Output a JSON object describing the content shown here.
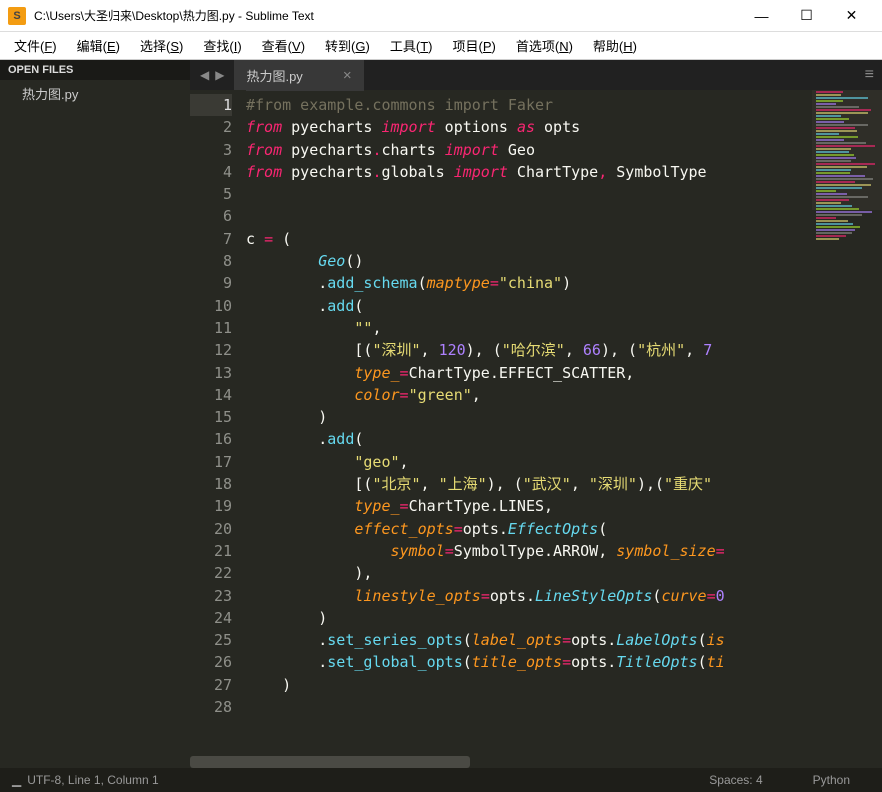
{
  "titlebar": {
    "icon_letter": "S",
    "title": "C:\\Users\\大圣归来\\Desktop\\热力图.py - Sublime Text"
  },
  "win": {
    "min": "—",
    "max": "☐",
    "close": "✕"
  },
  "menu": [
    {
      "t": "文件(",
      "u": "F",
      "s": ")"
    },
    {
      "t": "编辑(",
      "u": "E",
      "s": ")"
    },
    {
      "t": "选择(",
      "u": "S",
      "s": ")"
    },
    {
      "t": "查找(",
      "u": "I",
      "s": ")"
    },
    {
      "t": "查看(",
      "u": "V",
      "s": ")"
    },
    {
      "t": "转到(",
      "u": "G",
      "s": ")"
    },
    {
      "t": "工具(",
      "u": "T",
      "s": ")"
    },
    {
      "t": "项目(",
      "u": "P",
      "s": ")"
    },
    {
      "t": "首选项(",
      "u": "N",
      "s": ")"
    },
    {
      "t": "帮助(",
      "u": "H",
      "s": ")"
    }
  ],
  "sidebar": {
    "header": "OPEN FILES",
    "items": [
      "热力图.py"
    ]
  },
  "tabs": {
    "nav_prev": "◀",
    "nav_next": "▶",
    "active_name": "热力图.py",
    "close": "×",
    "hamburger": "≡"
  },
  "code": {
    "lines": [
      {
        "n": 1,
        "active": true,
        "seg": [
          [
            "cm",
            "#from example.commons import Faker"
          ]
        ]
      },
      {
        "n": 2,
        "seg": [
          [
            "kw",
            "from"
          ],
          [
            "wp",
            " pyecharts "
          ],
          [
            "kw",
            "import"
          ],
          [
            "wp",
            " options "
          ],
          [
            "kw",
            "as"
          ],
          [
            "wp",
            " opts"
          ]
        ]
      },
      {
        "n": 3,
        "seg": [
          [
            "kw",
            "from"
          ],
          [
            "wp",
            " pyecharts"
          ],
          [
            "op",
            "."
          ],
          [
            "wp",
            "charts "
          ],
          [
            "kw",
            "import"
          ],
          [
            "wp",
            " Geo"
          ]
        ]
      },
      {
        "n": 4,
        "seg": [
          [
            "kw",
            "from"
          ],
          [
            "wp",
            " pyecharts"
          ],
          [
            "op",
            "."
          ],
          [
            "wp",
            "globals "
          ],
          [
            "kw",
            "import"
          ],
          [
            "wp",
            " ChartType"
          ],
          [
            "op",
            ","
          ],
          [
            "wp",
            " SymbolType"
          ]
        ]
      },
      {
        "n": 5,
        "seg": []
      },
      {
        "n": 6,
        "seg": []
      },
      {
        "n": 7,
        "seg": [
          [
            "wp",
            "c "
          ],
          [
            "op",
            "="
          ],
          [
            "wp",
            " ("
          ]
        ]
      },
      {
        "n": 8,
        "seg": [
          [
            "wp",
            "        "
          ],
          [
            "cls",
            "Geo"
          ],
          [
            "wp",
            "()"
          ]
        ]
      },
      {
        "n": 9,
        "seg": [
          [
            "wp",
            "        ."
          ],
          [
            "fn",
            "add_schema"
          ],
          [
            "wp",
            "("
          ],
          [
            "par",
            "maptype"
          ],
          [
            "op",
            "="
          ],
          [
            "str",
            "\"china\""
          ],
          [
            "wp",
            ")"
          ]
        ]
      },
      {
        "n": 10,
        "seg": [
          [
            "wp",
            "        ."
          ],
          [
            "fn",
            "add"
          ],
          [
            "wp",
            "("
          ]
        ]
      },
      {
        "n": 11,
        "seg": [
          [
            "wp",
            "            "
          ],
          [
            "str",
            "\"\""
          ],
          [
            "wp",
            ","
          ]
        ]
      },
      {
        "n": 12,
        "seg": [
          [
            "wp",
            "            [("
          ],
          [
            "str",
            "\"深圳\""
          ],
          [
            "wp",
            ", "
          ],
          [
            "num",
            "120"
          ],
          [
            "wp",
            "), ("
          ],
          [
            "str",
            "\"哈尔滨\""
          ],
          [
            "wp",
            ", "
          ],
          [
            "num",
            "66"
          ],
          [
            "wp",
            "), ("
          ],
          [
            "str",
            "\"杭州\""
          ],
          [
            "wp",
            ", "
          ],
          [
            "num",
            "7"
          ]
        ]
      },
      {
        "n": 13,
        "seg": [
          [
            "wp",
            "            "
          ],
          [
            "par",
            "type_"
          ],
          [
            "op",
            "="
          ],
          [
            "wp",
            "ChartType.EFFECT_SCATTER,"
          ]
        ]
      },
      {
        "n": 14,
        "seg": [
          [
            "wp",
            "            "
          ],
          [
            "par",
            "color"
          ],
          [
            "op",
            "="
          ],
          [
            "str",
            "\"green\""
          ],
          [
            "wp",
            ","
          ]
        ]
      },
      {
        "n": 15,
        "seg": [
          [
            "wp",
            "        )"
          ]
        ]
      },
      {
        "n": 16,
        "seg": [
          [
            "wp",
            "        ."
          ],
          [
            "fn",
            "add"
          ],
          [
            "wp",
            "("
          ]
        ]
      },
      {
        "n": 17,
        "seg": [
          [
            "wp",
            "            "
          ],
          [
            "str",
            "\"geo\""
          ],
          [
            "wp",
            ","
          ]
        ]
      },
      {
        "n": 18,
        "seg": [
          [
            "wp",
            "            [("
          ],
          [
            "str",
            "\"北京\""
          ],
          [
            "wp",
            ", "
          ],
          [
            "str",
            "\"上海\""
          ],
          [
            "wp",
            "), ("
          ],
          [
            "str",
            "\"武汉\""
          ],
          [
            "wp",
            ", "
          ],
          [
            "str",
            "\"深圳\""
          ],
          [
            "wp",
            "),("
          ],
          [
            "str",
            "\"重庆\""
          ]
        ]
      },
      {
        "n": 19,
        "seg": [
          [
            "wp",
            "            "
          ],
          [
            "par",
            "type_"
          ],
          [
            "op",
            "="
          ],
          [
            "wp",
            "ChartType.LINES,"
          ]
        ]
      },
      {
        "n": 20,
        "seg": [
          [
            "wp",
            "            "
          ],
          [
            "par",
            "effect_opts"
          ],
          [
            "op",
            "="
          ],
          [
            "wp",
            "opts."
          ],
          [
            "cls",
            "EffectOpts"
          ],
          [
            "wp",
            "("
          ]
        ]
      },
      {
        "n": 21,
        "seg": [
          [
            "wp",
            "                "
          ],
          [
            "par",
            "symbol"
          ],
          [
            "op",
            "="
          ],
          [
            "wp",
            "SymbolType.ARROW, "
          ],
          [
            "par",
            "symbol_size"
          ],
          [
            "op",
            "="
          ]
        ]
      },
      {
        "n": 22,
        "seg": [
          [
            "wp",
            "            ),"
          ]
        ]
      },
      {
        "n": 23,
        "seg": [
          [
            "wp",
            "            "
          ],
          [
            "par",
            "linestyle_opts"
          ],
          [
            "op",
            "="
          ],
          [
            "wp",
            "opts."
          ],
          [
            "cls",
            "LineStyleOpts"
          ],
          [
            "wp",
            "("
          ],
          [
            "par",
            "curve"
          ],
          [
            "op",
            "="
          ],
          [
            "num",
            "0"
          ]
        ]
      },
      {
        "n": 24,
        "seg": [
          [
            "wp",
            "        )"
          ]
        ]
      },
      {
        "n": 25,
        "seg": [
          [
            "wp",
            "        ."
          ],
          [
            "fn",
            "set_series_opts"
          ],
          [
            "wp",
            "("
          ],
          [
            "par",
            "label_opts"
          ],
          [
            "op",
            "="
          ],
          [
            "wp",
            "opts."
          ],
          [
            "cls",
            "LabelOpts"
          ],
          [
            "wp",
            "("
          ],
          [
            "par",
            "is"
          ]
        ]
      },
      {
        "n": 26,
        "seg": [
          [
            "wp",
            "        ."
          ],
          [
            "fn",
            "set_global_opts"
          ],
          [
            "wp",
            "("
          ],
          [
            "par",
            "title_opts"
          ],
          [
            "op",
            "="
          ],
          [
            "wp",
            "opts."
          ],
          [
            "cls",
            "TitleOpts"
          ],
          [
            "wp",
            "("
          ],
          [
            "par",
            "ti"
          ]
        ]
      },
      {
        "n": 27,
        "seg": [
          [
            "wp",
            "    )"
          ]
        ]
      },
      {
        "n": 28,
        "seg": []
      }
    ]
  },
  "status": {
    "encoding": "UTF-8, Line 1, Column 1",
    "spaces": "Spaces: 4",
    "lang": "Python"
  }
}
